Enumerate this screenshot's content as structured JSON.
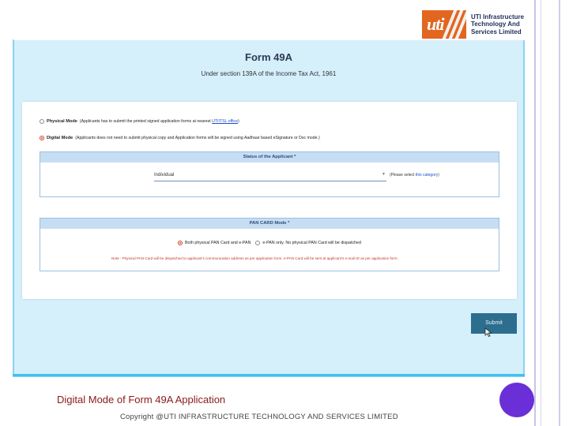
{
  "logo": {
    "mark": "uti",
    "name_lines": [
      "UTI Infrastructure",
      "Technology And",
      "Services Limited"
    ]
  },
  "form": {
    "title": "Form 49A",
    "subtitle": "Under section 139A of the Income Tax Act, 1961",
    "modes": [
      {
        "label": "Physical Mode",
        "description": "(Applicants has to submit the printed signed application forms at nearest",
        "link": "UTIITSL office",
        "suffix": ")",
        "selected": false
      },
      {
        "label": "Digital Mode",
        "description": "(Applicants does not need to submit physical copy and Application forms will be signed using Aadhaar based eSignature or Dsc mode.)",
        "selected": true
      }
    ],
    "status_section": {
      "heading": "Status of the Applicant *",
      "selected_value": "Individual",
      "hint_prefix": "(Please select",
      "hint_link": "this category",
      "hint_suffix": ")"
    },
    "pan_section": {
      "heading": "PAN CARD Mode *",
      "option_both": "Both physical PAN Card and e-PAN",
      "option_epan": "e-PAN only. No physical PAN Card will be dispatched",
      "both_selected": true,
      "note": "Note : Physical PAN Card will be dispatched to applicant's communication address as per application form. e-PAN Card will be sent at applicant's e-mail ID as per application form."
    },
    "submit_label": "Submit"
  },
  "caption": "Digital Mode of Form 49A Application",
  "copyright": "Copyright @UTI INFRASTRUCTURE TECHNOLOGY AND SERVICES LIMITED",
  "colors": {
    "accent_orange": "#e2661f",
    "panel_bg": "#d5effb",
    "caption_red": "#8b1a17",
    "purple_circle": "#6a2fd6",
    "submit_bg": "#2d6d8e"
  }
}
